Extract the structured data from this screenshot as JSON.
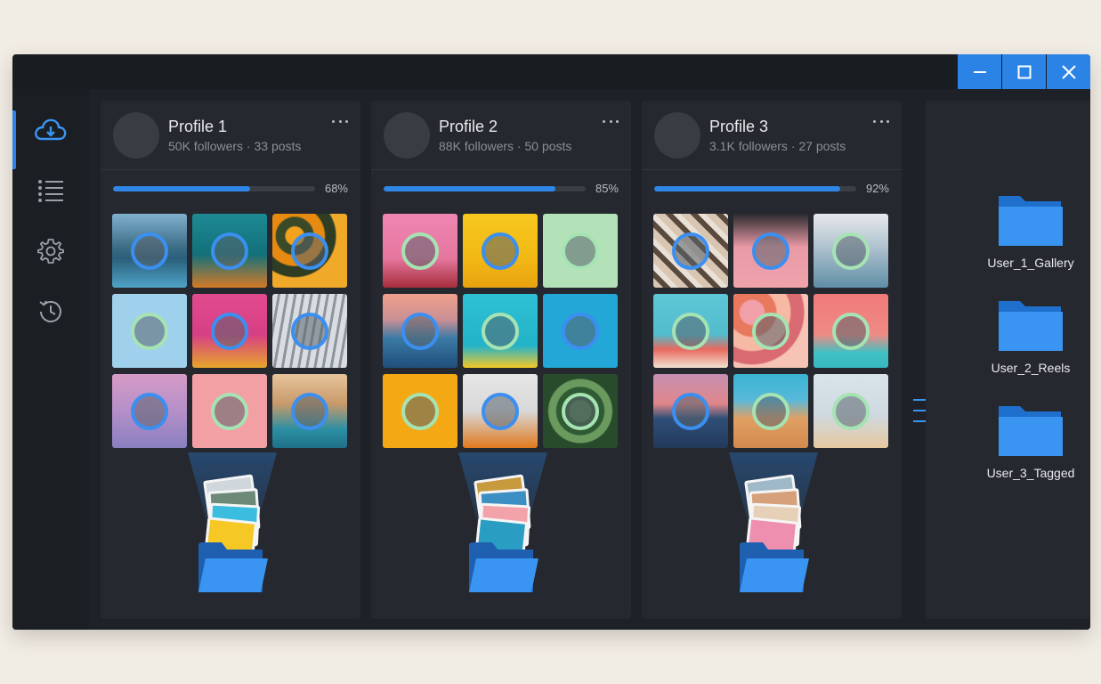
{
  "window": {
    "controls": [
      "minimize",
      "maximize",
      "close"
    ]
  },
  "sidebar": {
    "items": [
      {
        "icon": "cloud-download-icon",
        "active": true
      },
      {
        "icon": "list-icon",
        "active": false
      },
      {
        "icon": "gear-icon",
        "active": false
      },
      {
        "icon": "history-icon",
        "active": false
      }
    ]
  },
  "profiles": [
    {
      "name": "Profile 1",
      "stats": "50K followers · 33 posts",
      "progress_label": "68%",
      "progress": 0.68
    },
    {
      "name": "Profile 2",
      "stats": "88K followers · 50 posts",
      "progress_label": "85%",
      "progress": 0.85
    },
    {
      "name": "Profile 3",
      "stats": "3.1K followers · 27 posts",
      "progress_label": "92%",
      "progress": 0.92
    }
  ],
  "destinations": [
    {
      "label": "User_1_Gallery"
    },
    {
      "label": "User_2_Reels"
    },
    {
      "label": "User_3_Tagged"
    }
  ],
  "colors": {
    "accent": "#2b83e6",
    "ring_pending": "#3b8ff0",
    "ring_done": "#a6e3b3"
  }
}
